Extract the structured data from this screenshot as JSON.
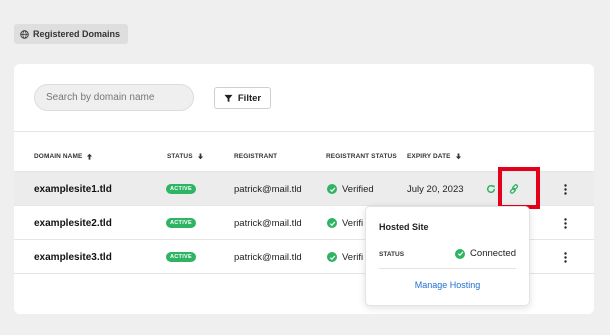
{
  "chip": {
    "label": "Registered Domains",
    "icon": "globe-icon"
  },
  "search": {
    "placeholder": "Search by domain name",
    "value": ""
  },
  "filter": {
    "label": "Filter",
    "icon": "filter-funnel-icon"
  },
  "columns": {
    "domain": "DOMAIN NAME",
    "status": "STATUS",
    "registrant": "REGISTRANT",
    "registrant_status": "REGISTRANT STATUS",
    "expiry": "EXPIRY DATE"
  },
  "rows": [
    {
      "domain": "examplesite1.tld",
      "status": "ACTIVE",
      "registrant": "patrick@mail.tld",
      "registrant_status": "Verified",
      "expiry": "July 20, 2023"
    },
    {
      "domain": "examplesite2.tld",
      "status": "ACTIVE",
      "registrant": "patrick@mail.tld",
      "registrant_status": "Verifi"
    },
    {
      "domain": "examplesite3.tld",
      "status": "ACTIVE",
      "registrant": "patrick@mail.tld",
      "registrant_status": "Verifi"
    }
  ],
  "popover": {
    "title": "Hosted Site",
    "status_label": "STATUS",
    "status_value": "Connected",
    "action": "Manage Hosting"
  },
  "colors": {
    "accent_green": "#2fb463",
    "link_blue": "#1f6fd1",
    "highlight_red": "#e3001b"
  }
}
